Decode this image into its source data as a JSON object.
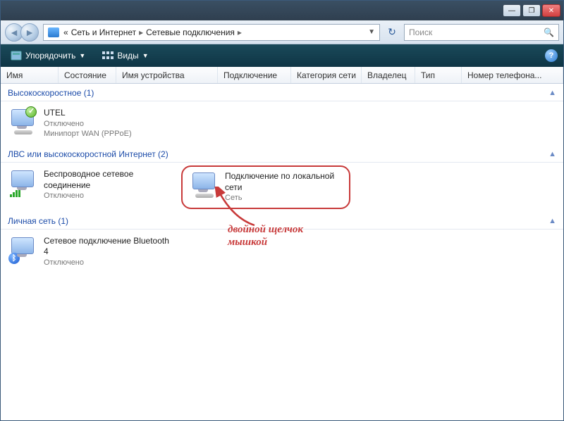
{
  "titlebar": {
    "minimize": "—",
    "maximize": "❐",
    "close": "✕"
  },
  "address": {
    "prefix": "«",
    "part1": "Сеть и Интернет",
    "part2": "Сетевые подключения",
    "sep": "▸"
  },
  "search": {
    "placeholder": "Поиск"
  },
  "toolbar": {
    "organize": "Упорядочить",
    "views": "Виды"
  },
  "columns": [
    "Имя",
    "Состояние",
    "Имя устройства",
    "Подключение",
    "Категория сети",
    "Владелец",
    "Тип",
    "Номер телефона..."
  ],
  "groups": [
    {
      "title": "Высокоскоростное (1)",
      "items": [
        {
          "title": "UTEL",
          "sub1": "Отключено",
          "sub2": "Минипорт WAN (PPPoE)",
          "icon": "dial-check"
        }
      ]
    },
    {
      "title": "ЛВС или высокоскоростной Интернет (2)",
      "items": [
        {
          "title": "Беспроводное сетевое соединение",
          "sub1": "Отключено",
          "sub2": "",
          "icon": "wifi"
        },
        {
          "title": "Подключение по локальной сети",
          "sub1": "Сеть",
          "sub2": "",
          "icon": "lan-cable",
          "highlighted": true
        }
      ]
    },
    {
      "title": "Личная сеть (1)",
      "items": [
        {
          "title": "Сетевое подключение Bluetooth 4",
          "sub1": "Отключено",
          "sub2": "",
          "icon": "bluetooth"
        }
      ]
    }
  ],
  "annotation": "двойной щелчок\nмышкой"
}
